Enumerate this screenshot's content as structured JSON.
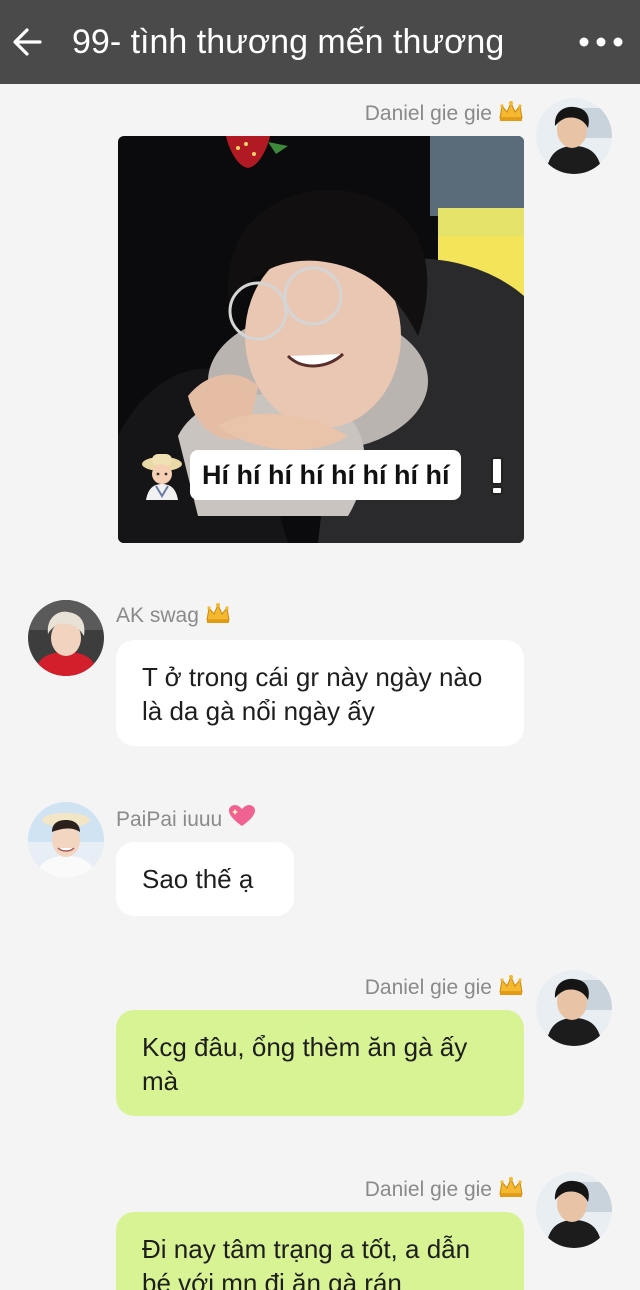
{
  "header": {
    "title": "99- tình thương mến thương",
    "back_icon": "arrow-left-icon",
    "more_icon": "ellipsis-icon"
  },
  "messages": [
    {
      "sender": "Daniel gie gie",
      "direction": "outgoing",
      "type": "sticker",
      "sticker_text": "Hí hí hí hí hí hí hí hí"
    },
    {
      "sender": "AK swag",
      "direction": "incoming",
      "type": "text",
      "text": "T ở trong cái gr này ngày nào là da gà nổi ngày ấy"
    },
    {
      "sender": "PaiPai iuuu",
      "direction": "incoming",
      "type": "text",
      "text": "Sao thế ạ"
    },
    {
      "sender": "Daniel gie gie",
      "direction": "outgoing",
      "type": "text",
      "text": "Kcg đâu, ổng thèm ăn gà ấy mà"
    },
    {
      "sender": "Daniel gie gie",
      "direction": "outgoing",
      "type": "text",
      "text": "Đi nay tâm trạng a tốt, a dẫn bé với mn đi ăn gà rán"
    }
  ],
  "colors": {
    "topbar": "#4a4a4a",
    "outgoing_bubble": "#d8f393",
    "incoming_bubble": "#ffffff",
    "background": "#f4f4f4"
  }
}
